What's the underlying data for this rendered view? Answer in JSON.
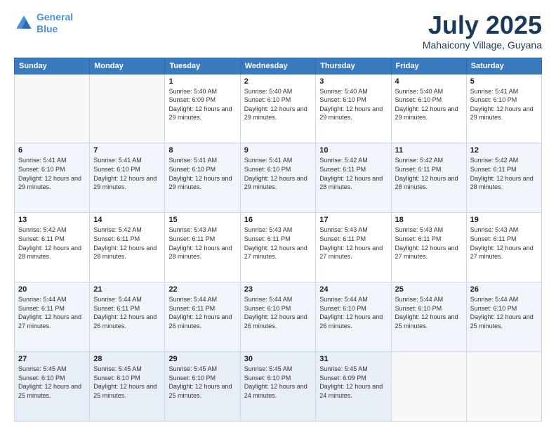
{
  "logo": {
    "line1": "General",
    "line2": "Blue"
  },
  "title": "July 2025",
  "subtitle": "Mahaicony Village, Guyana",
  "days_of_week": [
    "Sunday",
    "Monday",
    "Tuesday",
    "Wednesday",
    "Thursday",
    "Friday",
    "Saturday"
  ],
  "weeks": [
    [
      {
        "day": "",
        "info": ""
      },
      {
        "day": "",
        "info": ""
      },
      {
        "day": "1",
        "info": "Sunrise: 5:40 AM\nSunset: 6:09 PM\nDaylight: 12 hours and 29 minutes."
      },
      {
        "day": "2",
        "info": "Sunrise: 5:40 AM\nSunset: 6:10 PM\nDaylight: 12 hours and 29 minutes."
      },
      {
        "day": "3",
        "info": "Sunrise: 5:40 AM\nSunset: 6:10 PM\nDaylight: 12 hours and 29 minutes."
      },
      {
        "day": "4",
        "info": "Sunrise: 5:40 AM\nSunset: 6:10 PM\nDaylight: 12 hours and 29 minutes."
      },
      {
        "day": "5",
        "info": "Sunrise: 5:41 AM\nSunset: 6:10 PM\nDaylight: 12 hours and 29 minutes."
      }
    ],
    [
      {
        "day": "6",
        "info": "Sunrise: 5:41 AM\nSunset: 6:10 PM\nDaylight: 12 hours and 29 minutes."
      },
      {
        "day": "7",
        "info": "Sunrise: 5:41 AM\nSunset: 6:10 PM\nDaylight: 12 hours and 29 minutes."
      },
      {
        "day": "8",
        "info": "Sunrise: 5:41 AM\nSunset: 6:10 PM\nDaylight: 12 hours and 29 minutes."
      },
      {
        "day": "9",
        "info": "Sunrise: 5:41 AM\nSunset: 6:10 PM\nDaylight: 12 hours and 29 minutes."
      },
      {
        "day": "10",
        "info": "Sunrise: 5:42 AM\nSunset: 6:11 PM\nDaylight: 12 hours and 28 minutes."
      },
      {
        "day": "11",
        "info": "Sunrise: 5:42 AM\nSunset: 6:11 PM\nDaylight: 12 hours and 28 minutes."
      },
      {
        "day": "12",
        "info": "Sunrise: 5:42 AM\nSunset: 6:11 PM\nDaylight: 12 hours and 28 minutes."
      }
    ],
    [
      {
        "day": "13",
        "info": "Sunrise: 5:42 AM\nSunset: 6:11 PM\nDaylight: 12 hours and 28 minutes."
      },
      {
        "day": "14",
        "info": "Sunrise: 5:42 AM\nSunset: 6:11 PM\nDaylight: 12 hours and 28 minutes."
      },
      {
        "day": "15",
        "info": "Sunrise: 5:43 AM\nSunset: 6:11 PM\nDaylight: 12 hours and 28 minutes."
      },
      {
        "day": "16",
        "info": "Sunrise: 5:43 AM\nSunset: 6:11 PM\nDaylight: 12 hours and 27 minutes."
      },
      {
        "day": "17",
        "info": "Sunrise: 5:43 AM\nSunset: 6:11 PM\nDaylight: 12 hours and 27 minutes."
      },
      {
        "day": "18",
        "info": "Sunrise: 5:43 AM\nSunset: 6:11 PM\nDaylight: 12 hours and 27 minutes."
      },
      {
        "day": "19",
        "info": "Sunrise: 5:43 AM\nSunset: 6:11 PM\nDaylight: 12 hours and 27 minutes."
      }
    ],
    [
      {
        "day": "20",
        "info": "Sunrise: 5:44 AM\nSunset: 6:11 PM\nDaylight: 12 hours and 27 minutes."
      },
      {
        "day": "21",
        "info": "Sunrise: 5:44 AM\nSunset: 6:11 PM\nDaylight: 12 hours and 26 minutes."
      },
      {
        "day": "22",
        "info": "Sunrise: 5:44 AM\nSunset: 6:11 PM\nDaylight: 12 hours and 26 minutes."
      },
      {
        "day": "23",
        "info": "Sunrise: 5:44 AM\nSunset: 6:10 PM\nDaylight: 12 hours and 26 minutes."
      },
      {
        "day": "24",
        "info": "Sunrise: 5:44 AM\nSunset: 6:10 PM\nDaylight: 12 hours and 26 minutes."
      },
      {
        "day": "25",
        "info": "Sunrise: 5:44 AM\nSunset: 6:10 PM\nDaylight: 12 hours and 25 minutes."
      },
      {
        "day": "26",
        "info": "Sunrise: 5:44 AM\nSunset: 6:10 PM\nDaylight: 12 hours and 25 minutes."
      }
    ],
    [
      {
        "day": "27",
        "info": "Sunrise: 5:45 AM\nSunset: 6:10 PM\nDaylight: 12 hours and 25 minutes."
      },
      {
        "day": "28",
        "info": "Sunrise: 5:45 AM\nSunset: 6:10 PM\nDaylight: 12 hours and 25 minutes."
      },
      {
        "day": "29",
        "info": "Sunrise: 5:45 AM\nSunset: 6:10 PM\nDaylight: 12 hours and 25 minutes."
      },
      {
        "day": "30",
        "info": "Sunrise: 5:45 AM\nSunset: 6:10 PM\nDaylight: 12 hours and 24 minutes."
      },
      {
        "day": "31",
        "info": "Sunrise: 5:45 AM\nSunset: 6:09 PM\nDaylight: 12 hours and 24 minutes."
      },
      {
        "day": "",
        "info": ""
      },
      {
        "day": "",
        "info": ""
      }
    ]
  ]
}
